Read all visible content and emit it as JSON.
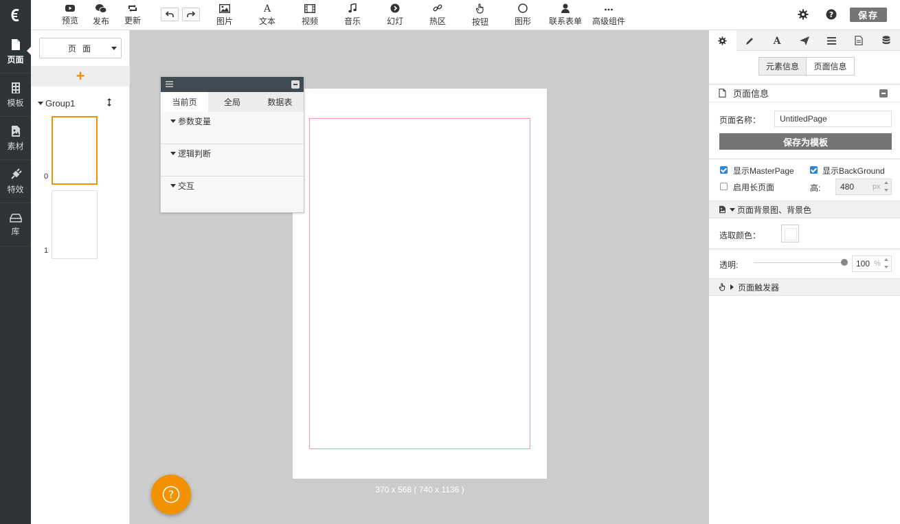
{
  "leftbar": {
    "logo": "€",
    "items": [
      {
        "label": "页面",
        "icon": "page-icon",
        "active": true
      },
      {
        "label": "模板",
        "icon": "template-icon"
      },
      {
        "label": "素材",
        "icon": "material-icon"
      },
      {
        "label": "特效",
        "icon": "plugin-icon"
      },
      {
        "label": "库",
        "icon": "library-icon"
      }
    ]
  },
  "toolbar": {
    "preview": "预览",
    "publish": "发布",
    "update": "更新",
    "image": "图片",
    "text": "文本",
    "video": "视频",
    "music": "音乐",
    "slideshow": "幻灯",
    "hotspot": "热区",
    "button": "按钮",
    "shape": "图形",
    "form": "联系表单",
    "advanced": "高级组件",
    "save": "保存",
    "accent": "#f39200"
  },
  "pages_panel": {
    "select_value": "页 面",
    "add_symbol": "+",
    "group_name": "Group1",
    "pages": [
      {
        "index": "0",
        "selected": true
      },
      {
        "index": "1",
        "selected": false
      }
    ]
  },
  "interaction_panel": {
    "tabs": [
      "当前页",
      "全局",
      "数据表"
    ],
    "active_tab": "当前页",
    "sections": [
      "参数变量",
      "逻辑判断",
      "交互"
    ]
  },
  "canvas": {
    "size_label": "370 x 568 ( 740 x 1136 )",
    "safe_area_color": "#f29aa5"
  },
  "right_panel": {
    "segment_tabs": [
      "元素信息",
      "页面信息"
    ],
    "active_segment": "页面信息",
    "section_title": "页面信息",
    "page_name_label": "页面名称：",
    "page_name_value": "UntitledPage",
    "save_template_label": "保存为模板",
    "show_master_label": "显示MasterPage",
    "show_master_checked": true,
    "show_background_label": "显示BackGround",
    "show_background_checked": true,
    "long_page_label": "启用长页面",
    "long_page_checked": false,
    "height_label": "高:",
    "height_value": "480",
    "height_unit": "px",
    "bg_section_label": "页面背景图、背景色",
    "pick_color_label": "选取颜色：",
    "picked_color": "#ffffff",
    "opacity_label": "透明:",
    "opacity_value": "100",
    "opacity_unit": "%",
    "opacity_fraction": 1.0,
    "trigger_label": "页面触发器"
  }
}
